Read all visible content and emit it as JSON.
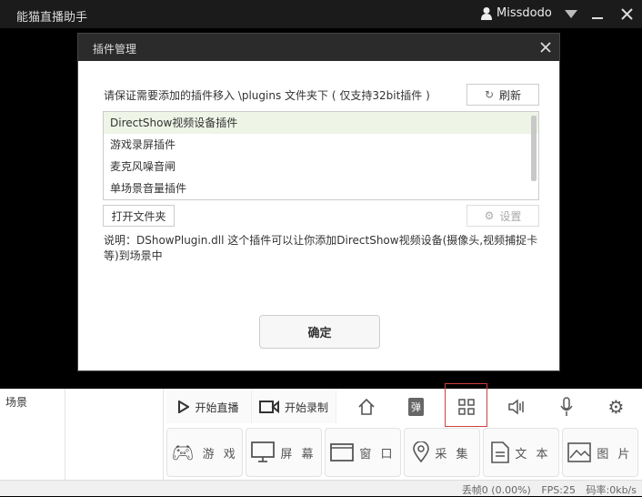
{
  "app": {
    "title": "能猫直播助手",
    "username": "Missdodo"
  },
  "dialog": {
    "title": "插件管理",
    "instruction": "请保证需要添加的插件移入 \\plugins 文件夹下 ( 仅支持32bit插件 )",
    "refresh_label": "刷新",
    "plugins": [
      "DirectShow视频设备插件",
      "游戏录屏插件",
      "麦克风噪音闸",
      "单场景音量插件"
    ],
    "open_folder_label": "打开文件夹",
    "settings_label": "设置",
    "description": "说明：DShowPlugin.dll 这个插件可以让你添加DirectShow视频设备(摄像头,视频捕捉卡等)到场景中",
    "ok_label": "确定"
  },
  "bottom": {
    "scene_label": "场景",
    "start_live": "开始直播",
    "start_record": "开始录制",
    "danmu_icon_text": "弹",
    "sources": [
      "游 戏",
      "屏 幕",
      "窗 口",
      "采 集",
      "文 本",
      "图 片"
    ]
  },
  "status": {
    "dropped": "丢帧0 (0.00%)",
    "fps": "FPS:25",
    "bitrate": "码率:0kb/s"
  },
  "colors": {
    "highlight": "#d04040",
    "selected_row": "#eef4e6"
  }
}
